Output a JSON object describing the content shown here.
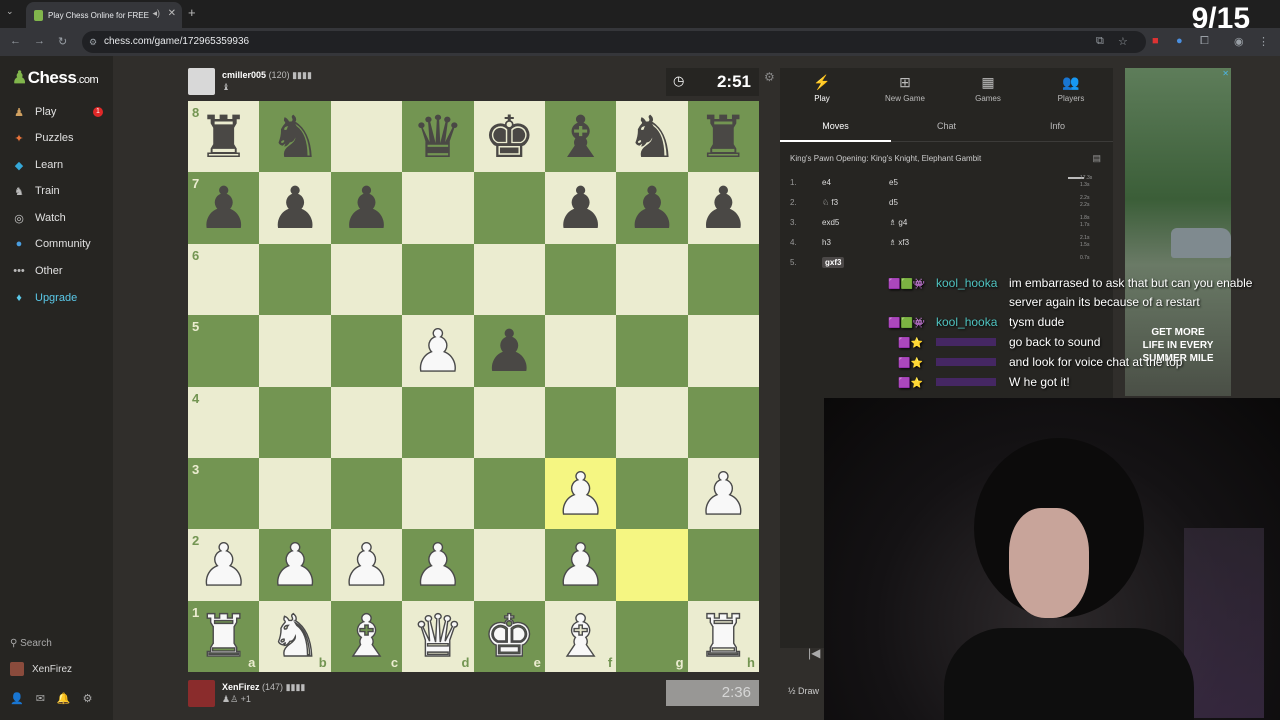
{
  "browser": {
    "tab_title": "Play Chess Online for FREE",
    "url": "chess.com/game/172965359936",
    "overlay_counter": "9/15"
  },
  "sidebar": {
    "logo": "Chess",
    "logo_suffix": ".com",
    "items": [
      {
        "label": "Play",
        "icon": "pawn-icon",
        "badge": "1"
      },
      {
        "label": "Puzzles",
        "icon": "puzzle-icon"
      },
      {
        "label": "Learn",
        "icon": "learn-icon"
      },
      {
        "label": "Train",
        "icon": "train-icon"
      },
      {
        "label": "Watch",
        "icon": "binoculars-icon"
      },
      {
        "label": "Community",
        "icon": "community-icon"
      },
      {
        "label": "Other",
        "icon": "more-icon"
      },
      {
        "label": "Upgrade",
        "icon": "diamond-icon"
      }
    ],
    "search_label": "Search",
    "username": "XenFirez",
    "notif_badge": "1"
  },
  "top_player": {
    "name": "cmiller005",
    "rating": "(120)",
    "clock": "2:51"
  },
  "bottom_player": {
    "name": "XenFirez",
    "rating": "(147)",
    "captured": "+1",
    "clock": "2:36"
  },
  "board": {
    "ranks": [
      "8",
      "7",
      "6",
      "5",
      "4",
      "3",
      "2",
      "1"
    ],
    "files": [
      "a",
      "b",
      "c",
      "d",
      "e",
      "f",
      "g",
      "h"
    ],
    "rows": [
      [
        "bR",
        "bN",
        "",
        "bQ",
        "bK",
        "bB",
        "bN",
        "bR"
      ],
      [
        "bP",
        "bP",
        "bP",
        "",
        "",
        "bP",
        "bP",
        "bP"
      ],
      [
        "",
        "",
        "",
        "",
        "",
        "",
        "",
        ""
      ],
      [
        "",
        "",
        "",
        "wP",
        "bP",
        "",
        "",
        ""
      ],
      [
        "",
        "",
        "",
        "",
        "",
        "",
        "",
        ""
      ],
      [
        "",
        "",
        "",
        "",
        "",
        "wP",
        "",
        "wP"
      ],
      [
        "wP",
        "wP",
        "wP",
        "wP",
        "",
        "wP",
        "",
        ""
      ],
      [
        "wR",
        "wN",
        "wB",
        "wQ",
        "wK",
        "wB",
        "",
        "wR"
      ]
    ],
    "highlight": [
      "f3",
      "g2"
    ]
  },
  "panel": {
    "tabs": [
      "Play",
      "New Game",
      "Games",
      "Players"
    ],
    "subtabs": [
      "Moves",
      "Chat",
      "Info"
    ],
    "opening": "King's Pawn Opening: King's Knight, Elephant Gambit",
    "moves": [
      {
        "n": "1.",
        "w": "e4",
        "b": "e5",
        "t1": "17.3s",
        "t2": "1.3s"
      },
      {
        "n": "2.",
        "w": "f3",
        "b": "d5",
        "t1": "2.2s",
        "t2": "2.2s",
        "wpiece": true
      },
      {
        "n": "3.",
        "w": "exd5",
        "b": "g4",
        "t1": "1.8s",
        "t2": "1.7s",
        "bpiece": true
      },
      {
        "n": "4.",
        "w": "h3",
        "b": "xf3",
        "t1": "2.1s",
        "t2": "1.5s",
        "bpiece": true
      },
      {
        "n": "5.",
        "w": "gxf3",
        "b": "",
        "t1": "0.7s",
        "t2": ""
      }
    ],
    "draw_label": "Draw"
  },
  "ad": {
    "text_lines": [
      "GET MORE",
      "LIFE IN EVERY",
      "SUMMER MILE"
    ]
  },
  "chat": [
    {
      "user": "kool_hooka",
      "color": "#4fc3c0",
      "msg": "im embarrased to ask that but can you enable",
      "cont": "server again its because of a restart"
    },
    {
      "user": "kool_hooka",
      "color": "#4fc3c0",
      "msg": "tysm dude"
    },
    {
      "user": "",
      "color": "#8c3be0",
      "msg": "go back to sound"
    },
    {
      "user": "",
      "color": "#8c3be0",
      "msg": "and look for voice chat at the top"
    },
    {
      "user": "",
      "color": "#8c3be0",
      "msg": "W he got it!"
    }
  ]
}
